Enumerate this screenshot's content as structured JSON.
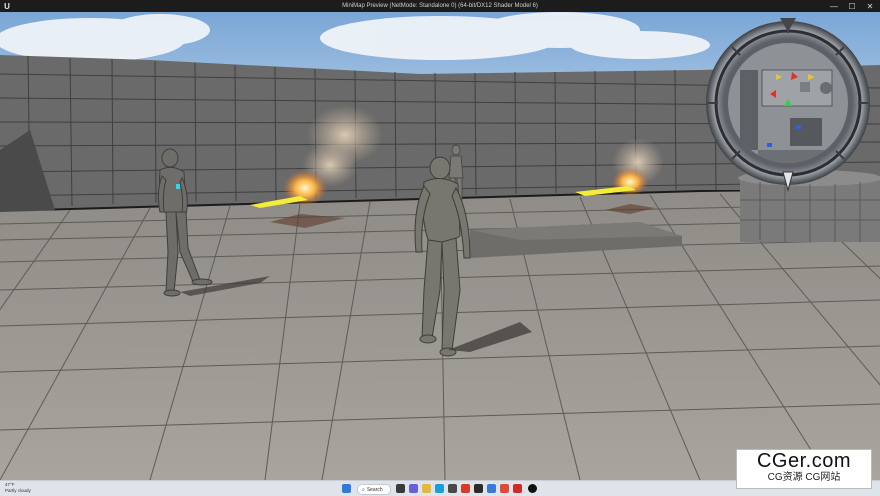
{
  "window": {
    "title": "MiniMap Preview (NetMode: Standalone 0) (64-bit/DX12 Shader Model 6)",
    "logo": "U",
    "minimize": "—",
    "maximize": "☐",
    "close": "✕"
  },
  "hud": {
    "minimap_markers": [
      "red-triangle",
      "red-triangle",
      "yellow-triangle",
      "red-triangle",
      "green-triangle",
      "blue-marker",
      "blue-marker"
    ],
    "compass_icon": "compass-ring-icon"
  },
  "taskbar": {
    "weather_temp": "47°F",
    "weather_desc": "Partly cloudy",
    "search_label": "Search",
    "icons": [
      "windows-icon",
      "search-icon",
      "task-view-icon",
      "chat-icon",
      "file-explorer-icon",
      "edge-icon",
      "store-icon",
      "app-icon",
      "app-icon",
      "app-icon",
      "app-icon",
      "app-icon",
      "unreal-icon"
    ]
  },
  "watermark": {
    "main": "CGer.com",
    "sub": "CG资源 CG网站"
  },
  "colors": {
    "sky": "#8fb6dc",
    "floor": "#9c9993",
    "wall": "#6b6b6b",
    "minimap_bg": "#8e9196",
    "fire": "#f2a23a",
    "lightning": "#f4ec3a"
  }
}
